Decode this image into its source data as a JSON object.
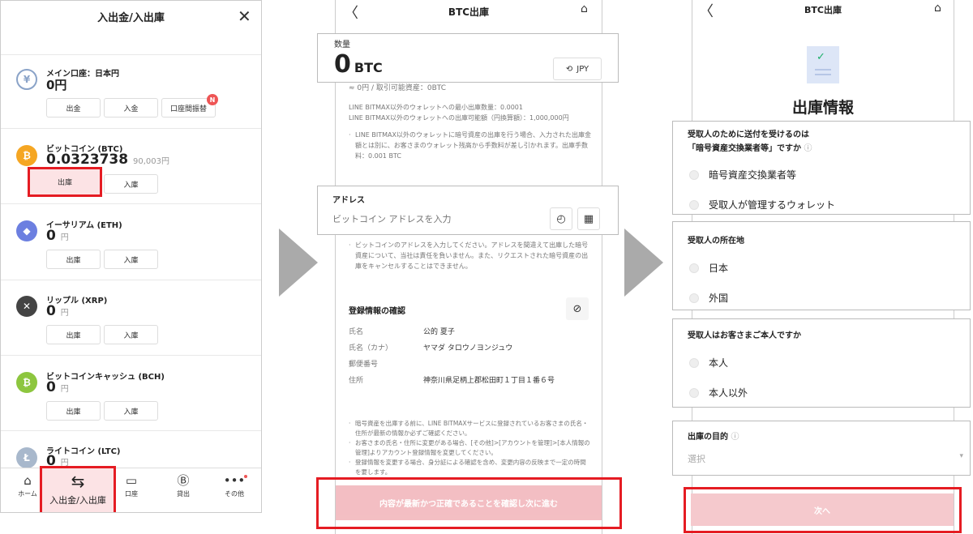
{
  "screen1": {
    "title": "入出金/入出庫",
    "jpy": {
      "name": "メイン口座：日本円",
      "amount": "0円",
      "buttons": [
        "出金",
        "入金",
        "口座間振替"
      ],
      "badge": "N"
    },
    "assets": [
      {
        "name": "ビットコイン (BTC)",
        "amount": "0.0323738",
        "jpy": "90,003円",
        "icon": "bitcoin-icon",
        "color": "#f5a623",
        "symbol": "₿"
      },
      {
        "name": "イーサリアム (ETH)",
        "amount": "0",
        "jpy": "円",
        "icon": "ethereum-icon",
        "color": "#6c7fe0",
        "symbol": "◆"
      },
      {
        "name": "リップル (XRP)",
        "amount": "0",
        "jpy": "円",
        "icon": "ripple-icon",
        "color": "#444",
        "symbol": "✕"
      },
      {
        "name": "ビットコインキャッシュ (BCH)",
        "amount": "0",
        "jpy": "円",
        "icon": "bitcoin-cash-icon",
        "color": "#8dc63f",
        "symbol": "₿"
      },
      {
        "name": "ライトコイン (LTC)",
        "amount": "0",
        "jpy": "円",
        "icon": "litecoin-icon",
        "color": "#a8b8cc",
        "symbol": "Ł"
      }
    ],
    "withdraw": "出庫",
    "deposit": "入庫",
    "nav": {
      "home": "ホーム",
      "transfer": "入出金/入出庫",
      "account": "口座",
      "lend": "貸出",
      "other": "その他"
    }
  },
  "screen2": {
    "title": "BTC出庫",
    "qty_label": "数量",
    "qty_value": "0",
    "qty_unit": "BTC",
    "jpy_toggle": "JPY",
    "available": "≈ 0円 / 取引可能資産：0BTC",
    "min_note": "LINE BITMAX以外のウォレットへの最小出庫数量：0.0001",
    "max_note": "LINE BITMAX以外のウォレットへの出庫可能額（円換算額）：1,000,000円",
    "fee_note": "LINE BITMAX以外のウォレットに暗号資産の出庫を行う場合、入力された出庫金額とは別に、お客さまのウォレット残高から手数料が差し引かれます。出庫手数料：0.001 BTC",
    "address_label": "アドレス",
    "address_placeholder": "ビットコイン アドレスを入力",
    "address_note": "ビットコインのアドレスを入力してください。アドレスを間違えて出庫した暗号資産について、当社は責任を負いません。また、リクエストされた暗号資産の出庫をキャンセルすることはできません。",
    "reg_title": "登録情報の確認",
    "reg": [
      {
        "label": "氏名",
        "value": "公的 夏子"
      },
      {
        "label": "氏名（カナ）",
        "value": "ヤマダ タロウノヨンジュウ"
      },
      {
        "label": "郵便番号",
        "value": ""
      },
      {
        "label": "住所",
        "value": "神奈川県足柄上郡松田町１丁目１番６号"
      }
    ],
    "notes": [
      "暗号資産を出庫する前に、LINE BITMAXサービスに登録されているお客さまの氏名・住所が最新の情報か必ずご確認ください。",
      "お客さまの氏名・住所に変更がある場合、[その他]>[アカウントを管理]>[本人情報の管理]よりアカウント登録情報を変更してください。",
      "登録情報を変更する場合、身分証による確認を含め、変更内容の反映まで一定の時間を要します。"
    ],
    "confirm_button": "内容が最新かつ正確であることを確認し次に進む"
  },
  "screen3": {
    "title": "BTC出庫",
    "heading": "出庫情報",
    "q1": "受取人のために送付を受けるのは",
    "q1b": "「暗号資産交換業者等」ですか",
    "q1_options": [
      "暗号資産交換業者等",
      "受取人が管理するウォレット"
    ],
    "q2": "受取人の所在地",
    "q2_options": [
      "日本",
      "外国"
    ],
    "q3": "受取人はお客さまご本人ですか",
    "q3_options": [
      "本人",
      "本人以外"
    ],
    "purpose_label": "出庫の目的",
    "purpose_placeholder": "選択",
    "next_button": "次へ"
  }
}
